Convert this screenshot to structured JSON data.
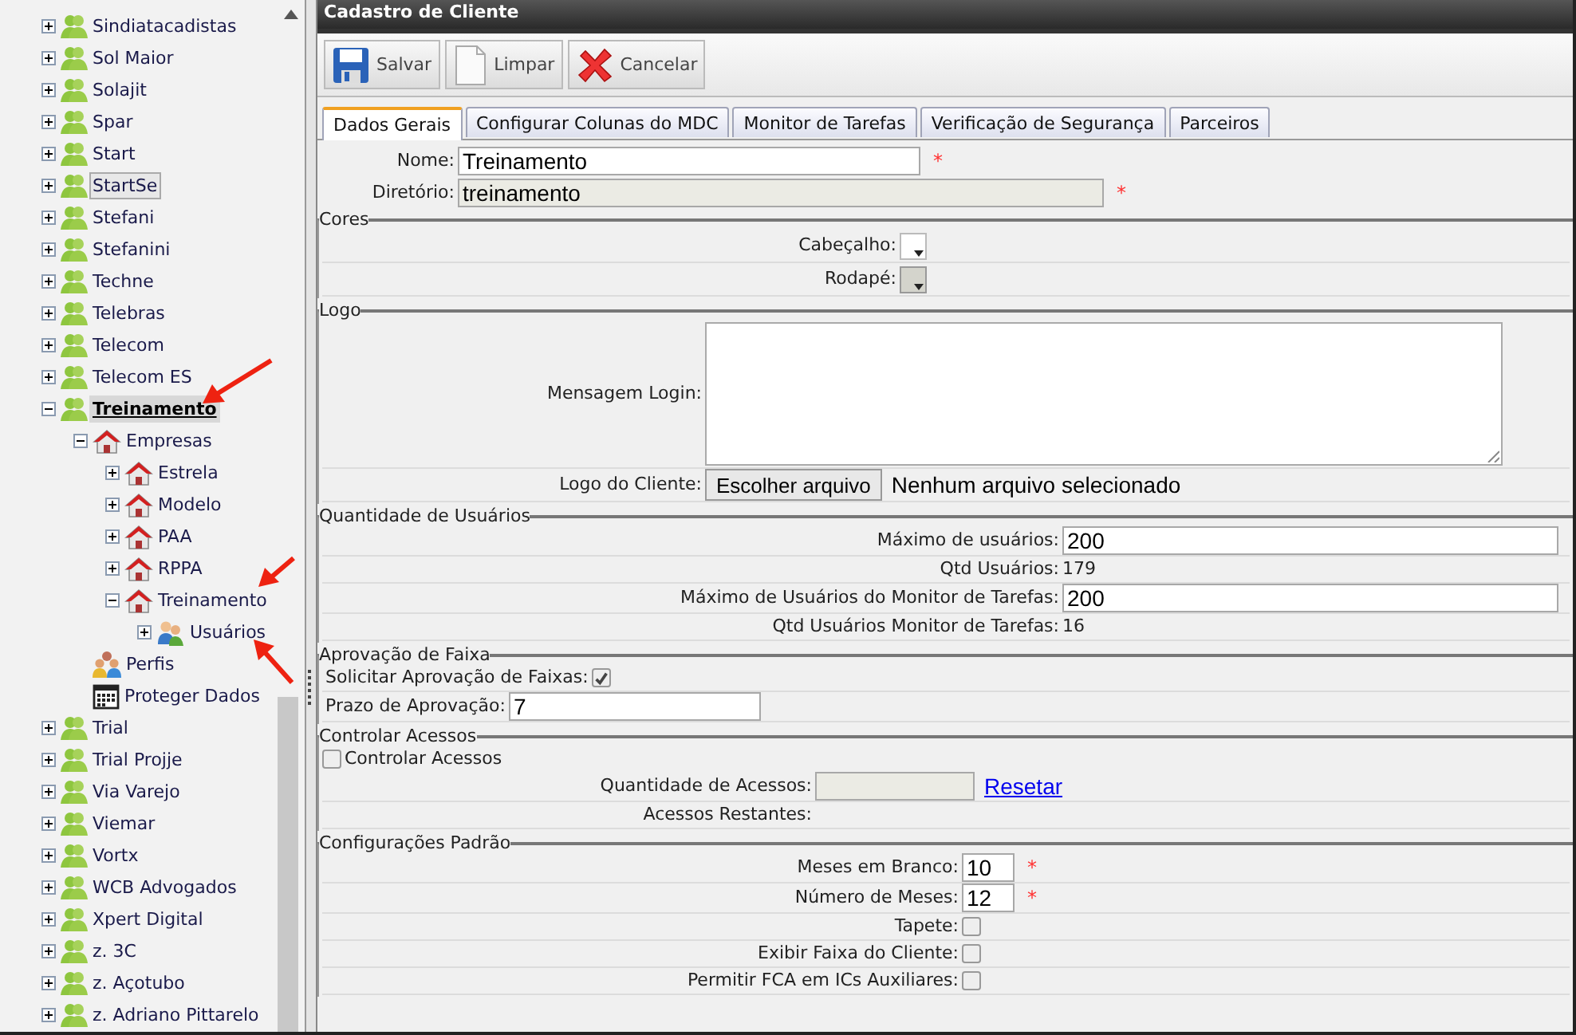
{
  "tree": [
    {
      "label": "Sindiatacadistas",
      "kind": "client",
      "expanded": false,
      "selected": false,
      "focused": false
    },
    {
      "label": "Sol Maior",
      "kind": "client",
      "expanded": false,
      "selected": false,
      "focused": false
    },
    {
      "label": "Solajit",
      "kind": "client",
      "expanded": false,
      "selected": false,
      "focused": false
    },
    {
      "label": "Spar",
      "kind": "client",
      "expanded": false,
      "selected": false,
      "focused": false
    },
    {
      "label": "Start",
      "kind": "client",
      "expanded": false,
      "selected": false,
      "focused": false
    },
    {
      "label": "StartSe",
      "kind": "client",
      "expanded": false,
      "selected": false,
      "focused": true
    },
    {
      "label": "Stefani",
      "kind": "client",
      "expanded": false,
      "selected": false,
      "focused": false
    },
    {
      "label": "Stefanini",
      "kind": "client",
      "expanded": false,
      "selected": false,
      "focused": false
    },
    {
      "label": "Techne",
      "kind": "client",
      "expanded": false,
      "selected": false,
      "focused": false
    },
    {
      "label": "Telebras",
      "kind": "client",
      "expanded": false,
      "selected": false,
      "focused": false
    },
    {
      "label": "Telecom",
      "kind": "client",
      "expanded": false,
      "selected": false,
      "focused": false
    },
    {
      "label": "Telecom ES",
      "kind": "client",
      "expanded": false,
      "selected": false,
      "focused": false
    },
    {
      "label": "Treinamento",
      "kind": "client",
      "expanded": true,
      "selected": true,
      "focused": false,
      "children": [
        {
          "label": "Empresas",
          "kind": "company",
          "expanded": true,
          "selected": false,
          "focused": false,
          "children": [
            {
              "label": "Estrela",
              "kind": "company",
              "expanded": false,
              "selected": false,
              "focused": false
            },
            {
              "label": "Modelo",
              "kind": "company",
              "expanded": false,
              "selected": false,
              "focused": false
            },
            {
              "label": "PAA",
              "kind": "company",
              "expanded": false,
              "selected": false,
              "focused": false
            },
            {
              "label": "RPPA",
              "kind": "company",
              "expanded": false,
              "selected": false,
              "focused": false
            },
            {
              "label": "Treinamento",
              "kind": "company",
              "expanded": true,
              "selected": false,
              "focused": false,
              "children": [
                {
                  "label": "Usuários",
                  "kind": "users",
                  "expanded": false,
                  "selected": false,
                  "focused": false
                }
              ]
            }
          ]
        },
        {
          "label": "Perfis",
          "kind": "profiles",
          "selected": false,
          "focused": false
        },
        {
          "label": "Proteger Dados",
          "kind": "calendar",
          "selected": false,
          "focused": false
        }
      ]
    },
    {
      "label": "Trial",
      "kind": "client",
      "expanded": false,
      "selected": false,
      "focused": false
    },
    {
      "label": "Trial Projje",
      "kind": "client",
      "expanded": false,
      "selected": false,
      "focused": false
    },
    {
      "label": "Via Varejo",
      "kind": "client",
      "expanded": false,
      "selected": false,
      "focused": false
    },
    {
      "label": "Viemar",
      "kind": "client",
      "expanded": false,
      "selected": false,
      "focused": false
    },
    {
      "label": "Vortx",
      "kind": "client",
      "expanded": false,
      "selected": false,
      "focused": false
    },
    {
      "label": "WCB Advogados",
      "kind": "client",
      "expanded": false,
      "selected": false,
      "focused": false
    },
    {
      "label": "Xpert Digital",
      "kind": "client",
      "expanded": false,
      "selected": false,
      "focused": false
    },
    {
      "label": "z. 3C",
      "kind": "client",
      "expanded": false,
      "selected": false,
      "focused": false
    },
    {
      "label": "z. Açotubo",
      "kind": "client",
      "expanded": false,
      "selected": false,
      "focused": false
    },
    {
      "label": "z. Adriano Pittarelo",
      "kind": "client",
      "expanded": false,
      "selected": false,
      "focused": false
    }
  ],
  "panel": {
    "title": "Cadastro de Cliente"
  },
  "toolbar": [
    {
      "label": "Salvar",
      "kind": "save"
    },
    {
      "label": "Limpar",
      "kind": "clear"
    },
    {
      "label": "Cancelar",
      "kind": "cancel"
    }
  ],
  "tabs": [
    {
      "label": "Dados Gerais",
      "selected": true
    },
    {
      "label": "Configurar Colunas do MDC",
      "selected": false
    },
    {
      "label": "Monitor de Tarefas",
      "selected": false
    },
    {
      "label": "Verificação de Segurança",
      "selected": false
    },
    {
      "label": "Parceiros",
      "selected": false
    }
  ],
  "fields": [
    {
      "label": "Nome:",
      "value": "Treinamento",
      "disabled": false,
      "required_mark": "*"
    },
    {
      "label": "Diretório:",
      "value": "treinamento",
      "disabled": true,
      "required_mark": "*"
    }
  ],
  "sections": [
    {
      "legend": "Cores",
      "rows": [
        {
          "kind": "color",
          "label": "Cabeçalho:",
          "disabled": false
        },
        {
          "kind": "color",
          "label": "Rodapé:",
          "disabled": true
        }
      ]
    },
    {
      "legend": "Logo",
      "rows": [
        {
          "kind": "textarea",
          "label": "Mensagem Login:"
        },
        {
          "kind": "file",
          "label": "Logo do Cliente:",
          "button": "Escolher arquivo",
          "value": "Nenhum arquivo selecionado"
        }
      ]
    },
    {
      "legend": "Quantidade de Usuários",
      "rows": [
        {
          "kind": "input",
          "label": "Máximo de usuários:",
          "value": "200",
          "disabled": false
        },
        {
          "kind": "text",
          "label": "Qtd Usuários:",
          "value": "179"
        },
        {
          "kind": "input",
          "label": "Máximo de Usuários do Monitor de Tarefas:",
          "value": "200",
          "disabled": false
        },
        {
          "kind": "text",
          "label": "Qtd Usuários Monitor de Tarefas:",
          "value": "16"
        }
      ]
    },
    {
      "legend": "Aprovação de Faixa",
      "rows": [
        {
          "kind": "check",
          "label": "Solicitar Aprovação de Faixas:",
          "checked": true
        },
        {
          "kind": "input",
          "label": "Prazo de Aprovação:",
          "value": "7",
          "disabled": false
        }
      ]
    },
    {
      "legend": "Controlar Acessos",
      "rows": [
        {
          "kind": "check-first",
          "label": "Controlar Acessos",
          "checked": false
        },
        {
          "kind": "access",
          "label": "Quantidade de Acessos:",
          "value": "",
          "disabled": true,
          "link": "Resetar"
        },
        {
          "kind": "text",
          "label": "Acessos Restantes:",
          "value": ""
        }
      ]
    },
    {
      "legend": "Configurações Padrão",
      "rows": [
        {
          "kind": "input",
          "label": "Meses em Branco:",
          "value": "10",
          "disabled": false,
          "required_mark": "*"
        },
        {
          "kind": "input",
          "label": "Número de Meses:",
          "value": "12",
          "disabled": false,
          "required_mark": "*"
        },
        {
          "kind": "check",
          "label": "Tapete:",
          "checked": false
        },
        {
          "kind": "check",
          "label": "Exibir Faixa do Cliente:",
          "checked": false
        },
        {
          "kind": "check",
          "label": "Permitir FCA em ICs Auxiliares:",
          "checked": false
        }
      ]
    }
  ]
}
